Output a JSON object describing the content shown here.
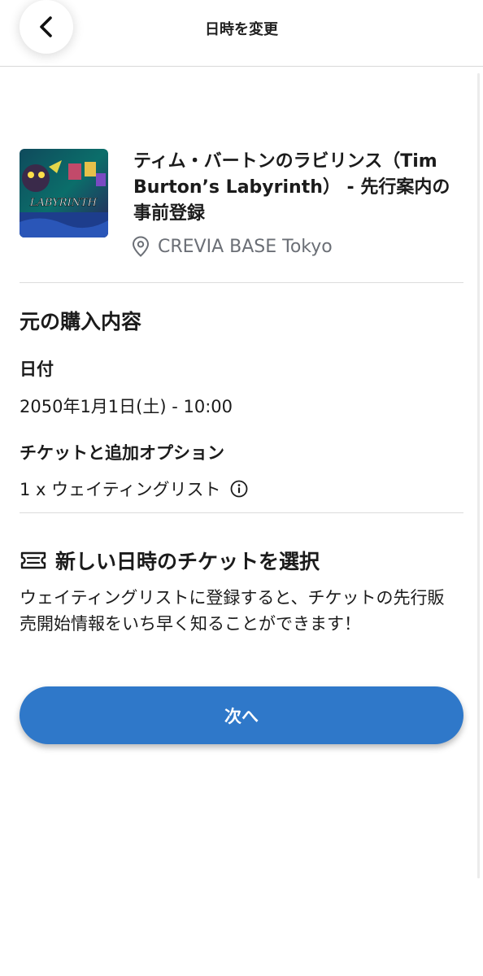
{
  "header": {
    "title": "日時を変更",
    "back_icon": "chevron-left-icon"
  },
  "event": {
    "title": "ティム・バートンのラビリンス（Tim Burton’s Labyrinth） - 先行案内の事前登録",
    "venue": "CREVIA BASE Tokyo",
    "venue_icon": "location-pin-icon",
    "poster_text": "LABYRINTH"
  },
  "original_purchase": {
    "heading": "元の購入内容",
    "date_label": "日付",
    "date_value": "2050年1月1日(土) - 10:00",
    "tickets_label": "チケットと追加オプション",
    "ticket_item": "1 x ウェイティングリスト",
    "info_icon": "info-icon"
  },
  "new_selection": {
    "icon": "ticket-icon",
    "heading": "新しい日時のチケットを選択",
    "description": "ウェイティングリストに登録すると、チケットの先行販売開始情報をいち早く知ることができます！"
  },
  "actions": {
    "next_label": "次へ"
  },
  "colors": {
    "primary": "#2f78c9",
    "muted_text": "#6b6f76",
    "divider": "#dcdcdc"
  }
}
